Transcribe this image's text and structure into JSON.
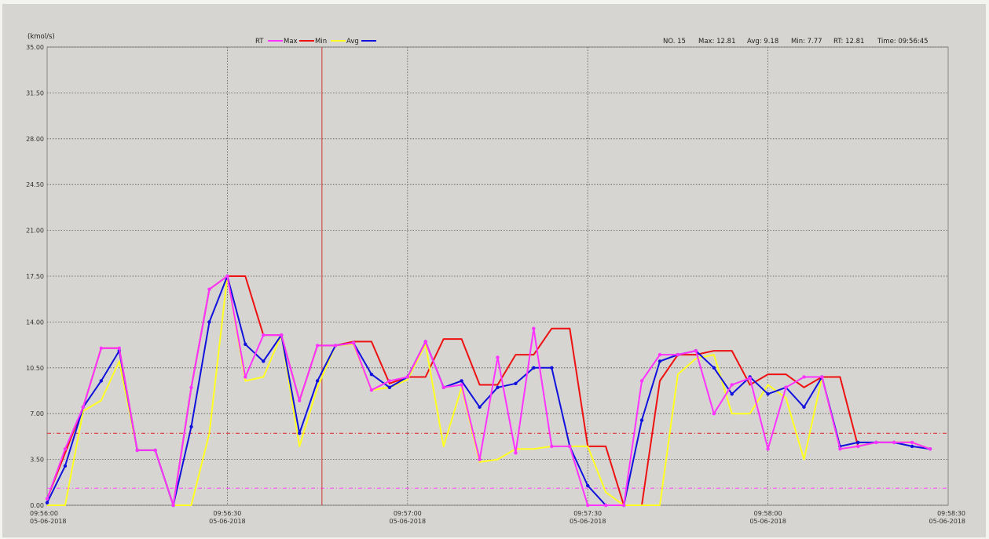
{
  "header": {
    "unit": "(kmol/s)",
    "legend": [
      {
        "label": "RT",
        "color": "#ff33ff"
      },
      {
        "label": "Max",
        "color": "#ee1111"
      },
      {
        "label": "Min",
        "color": "#ffff22"
      },
      {
        "label": "Avg",
        "color": "#1111dd"
      }
    ],
    "stats": {
      "no": "NO. 15",
      "max": "Max: 12.81",
      "avg": "Avg: 9.18",
      "min": "Min: 7.77",
      "rt": "RT: 12.81",
      "time": "Time: 09:56:45"
    }
  },
  "chart_data": {
    "type": "line",
    "ylabel": "(kmol/s)",
    "ylim": [
      0,
      35
    ],
    "xlim": [
      0,
      100
    ],
    "y_ticks": [
      "0.00",
      "3.50",
      "7.00",
      "10.50",
      "14.00",
      "17.50",
      "21.00",
      "24.50",
      "28.00",
      "31.50",
      "35.00"
    ],
    "x_ticks": [
      {
        "x": 0,
        "time": "09:56:00",
        "date": "05-06-2018"
      },
      {
        "x": 20,
        "time": "09:56:30",
        "date": "05-06-2018"
      },
      {
        "x": 40,
        "time": "09:57:00",
        "date": "05-06-2018"
      },
      {
        "x": 60,
        "time": "09:57:30",
        "date": "05-06-2018"
      },
      {
        "x": 80,
        "time": "09:58:00",
        "date": "05-06-2018"
      },
      {
        "x": 100,
        "time": "09:58:30",
        "date": "05-06-2018"
      }
    ],
    "grid": true,
    "reference_lines": [
      {
        "y": 5.5,
        "color": "#dd2222",
        "style": "dashdot"
      },
      {
        "y": 1.3,
        "color": "#ff44ff",
        "style": "dashdot"
      },
      {
        "x": 30.5,
        "color": "#cc3333",
        "style": "solid"
      }
    ],
    "series": [
      {
        "name": "Max",
        "color": "#ee1111",
        "markers": false,
        "x": [
          0,
          2,
          4,
          6,
          8,
          10,
          12,
          14,
          16,
          18,
          20,
          22,
          24,
          26,
          28,
          30,
          32,
          34,
          36,
          38,
          40,
          42,
          44,
          46,
          48,
          50,
          52,
          54,
          56,
          58,
          60,
          62,
          64,
          66,
          68,
          70,
          72,
          74,
          76,
          78,
          80,
          82,
          84,
          86,
          88,
          90,
          92,
          94,
          96,
          98
        ],
        "y": [
          0.5,
          4.0,
          7.5,
          12.0,
          12.0,
          4.2,
          4.2,
          0.0,
          9.0,
          16.5,
          17.5,
          17.5,
          13.0,
          13.0,
          8.0,
          12.2,
          12.2,
          12.5,
          12.5,
          9.3,
          9.8,
          9.8,
          12.7,
          12.7,
          9.2,
          9.2,
          11.5,
          11.5,
          13.5,
          13.5,
          4.5,
          4.5,
          0.0,
          0.0,
          9.5,
          11.5,
          11.5,
          11.8,
          11.8,
          9.2,
          10.0,
          10.0,
          9.0,
          9.8,
          9.8,
          4.5,
          4.8,
          4.8,
          4.8,
          4.3
        ]
      },
      {
        "name": "Min",
        "color": "#ffff22",
        "markers": false,
        "x": [
          0,
          2,
          4,
          6,
          8,
          10,
          12,
          14,
          16,
          18,
          20,
          22,
          24,
          26,
          28,
          30,
          32,
          34,
          36,
          38,
          40,
          42,
          44,
          46,
          48,
          50,
          52,
          54,
          56,
          58,
          60,
          62,
          64,
          66,
          68,
          70,
          72,
          74,
          76,
          78,
          80,
          82,
          84,
          86,
          88,
          90,
          92,
          94,
          96,
          98
        ],
        "y": [
          0.0,
          0.0,
          7.2,
          8.0,
          11.0,
          4.2,
          4.2,
          0.0,
          0.0,
          5.5,
          17.5,
          9.5,
          9.8,
          13.0,
          4.5,
          9.0,
          12.2,
          12.3,
          8.8,
          9.0,
          9.6,
          12.3,
          4.5,
          9.0,
          3.3,
          3.5,
          4.3,
          4.3,
          4.5,
          4.5,
          4.5,
          1.0,
          0.0,
          0.0,
          0.0,
          10.0,
          11.2,
          11.5,
          7.0,
          7.0,
          9.2,
          8.2,
          3.5,
          9.8,
          4.3,
          4.5,
          4.8,
          4.8,
          4.8,
          4.3
        ]
      },
      {
        "name": "Avg",
        "color": "#1111dd",
        "markers": true,
        "x": [
          0,
          2,
          4,
          6,
          8,
          10,
          12,
          14,
          16,
          18,
          20,
          22,
          24,
          26,
          28,
          30,
          32,
          34,
          36,
          38,
          40,
          42,
          44,
          46,
          48,
          50,
          52,
          54,
          56,
          58,
          60,
          62,
          64,
          66,
          68,
          70,
          72,
          74,
          76,
          78,
          80,
          82,
          84,
          86,
          88,
          90,
          92,
          94,
          96,
          98
        ],
        "y": [
          0.2,
          3.0,
          7.5,
          9.5,
          11.8,
          4.2,
          4.2,
          0.0,
          6.0,
          14.0,
          17.5,
          12.3,
          11.0,
          13.0,
          5.5,
          9.5,
          12.2,
          12.4,
          10.0,
          9.0,
          9.8,
          12.5,
          9.0,
          9.5,
          7.5,
          9.0,
          9.3,
          10.5,
          10.5,
          4.5,
          1.5,
          0.0,
          0.0,
          6.5,
          11.0,
          11.5,
          11.8,
          10.5,
          8.5,
          9.8,
          8.5,
          9.0,
          7.5,
          9.8,
          4.5,
          4.8,
          4.8,
          4.8,
          4.5,
          4.3
        ]
      },
      {
        "name": "RT",
        "color": "#ff33ff",
        "markers": true,
        "x": [
          0,
          2,
          4,
          6,
          8,
          10,
          12,
          14,
          16,
          18,
          20,
          22,
          24,
          26,
          28,
          30,
          32,
          34,
          36,
          38,
          40,
          42,
          44,
          46,
          48,
          50,
          52,
          54,
          56,
          58,
          60,
          62,
          64,
          66,
          68,
          70,
          72,
          74,
          76,
          78,
          80,
          82,
          84,
          86,
          88,
          90,
          92,
          94,
          96,
          98
        ],
        "y": [
          0.5,
          4.3,
          7.5,
          12.0,
          12.0,
          4.2,
          4.2,
          0.0,
          9.0,
          16.5,
          17.5,
          9.8,
          13.0,
          13.0,
          8.0,
          12.2,
          12.2,
          12.4,
          8.8,
          9.5,
          9.8,
          12.5,
          9.0,
          9.2,
          3.5,
          11.3,
          4.0,
          13.5,
          4.5,
          4.5,
          0.0,
          0.0,
          0.0,
          9.5,
          11.5,
          11.5,
          11.8,
          7.0,
          9.2,
          9.7,
          4.3,
          9.0,
          9.8,
          9.8,
          4.3,
          4.5,
          4.8,
          4.8,
          4.8,
          4.3
        ]
      }
    ]
  }
}
